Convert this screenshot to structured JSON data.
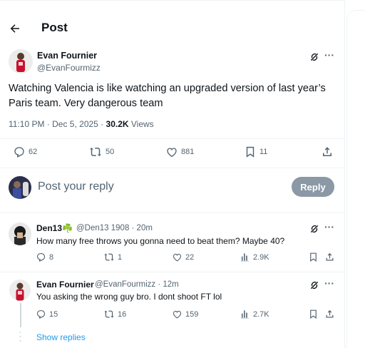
{
  "header": {
    "title": "Post"
  },
  "post": {
    "author_name": "Evan Fournier",
    "author_handle": "@EvanFourmizz",
    "text": "Watching Valencia is like watching an upgraded version of last year’s Paris team. Very dangerous team",
    "time": "11:10 PM · Dec 5, 2025 · ",
    "views_count": "30.2K",
    "views_label": " Views",
    "stats": {
      "replies": "62",
      "reposts": "50",
      "likes": "881",
      "bookmarks": "11"
    }
  },
  "reply_box": {
    "placeholder": "Post your reply",
    "button_label": "Reply"
  },
  "comments": [
    {
      "name": "Den13☘️",
      "handle": "@Den13 1908 · 20m",
      "text": "How many free throws you gonna need to beat them? Maybe 40?",
      "stats": {
        "replies": "8",
        "reposts": "1",
        "likes": "22",
        "views": "2.9K"
      }
    },
    {
      "name": "Evan Fournier",
      "handle": "@EvanFourmizz · 12m",
      "text": "You asking the wrong guy bro. I dont shoot FT lol",
      "stats": {
        "replies": "15",
        "reposts": "16",
        "likes": "159",
        "views": "2.7K"
      }
    }
  ],
  "show_replies": "Show replies",
  "icons": [
    "back-arrow-icon",
    "grok-icon",
    "more-icon",
    "reply-icon",
    "repost-icon",
    "like-icon",
    "bookmark-icon",
    "share-icon",
    "views-icon"
  ]
}
